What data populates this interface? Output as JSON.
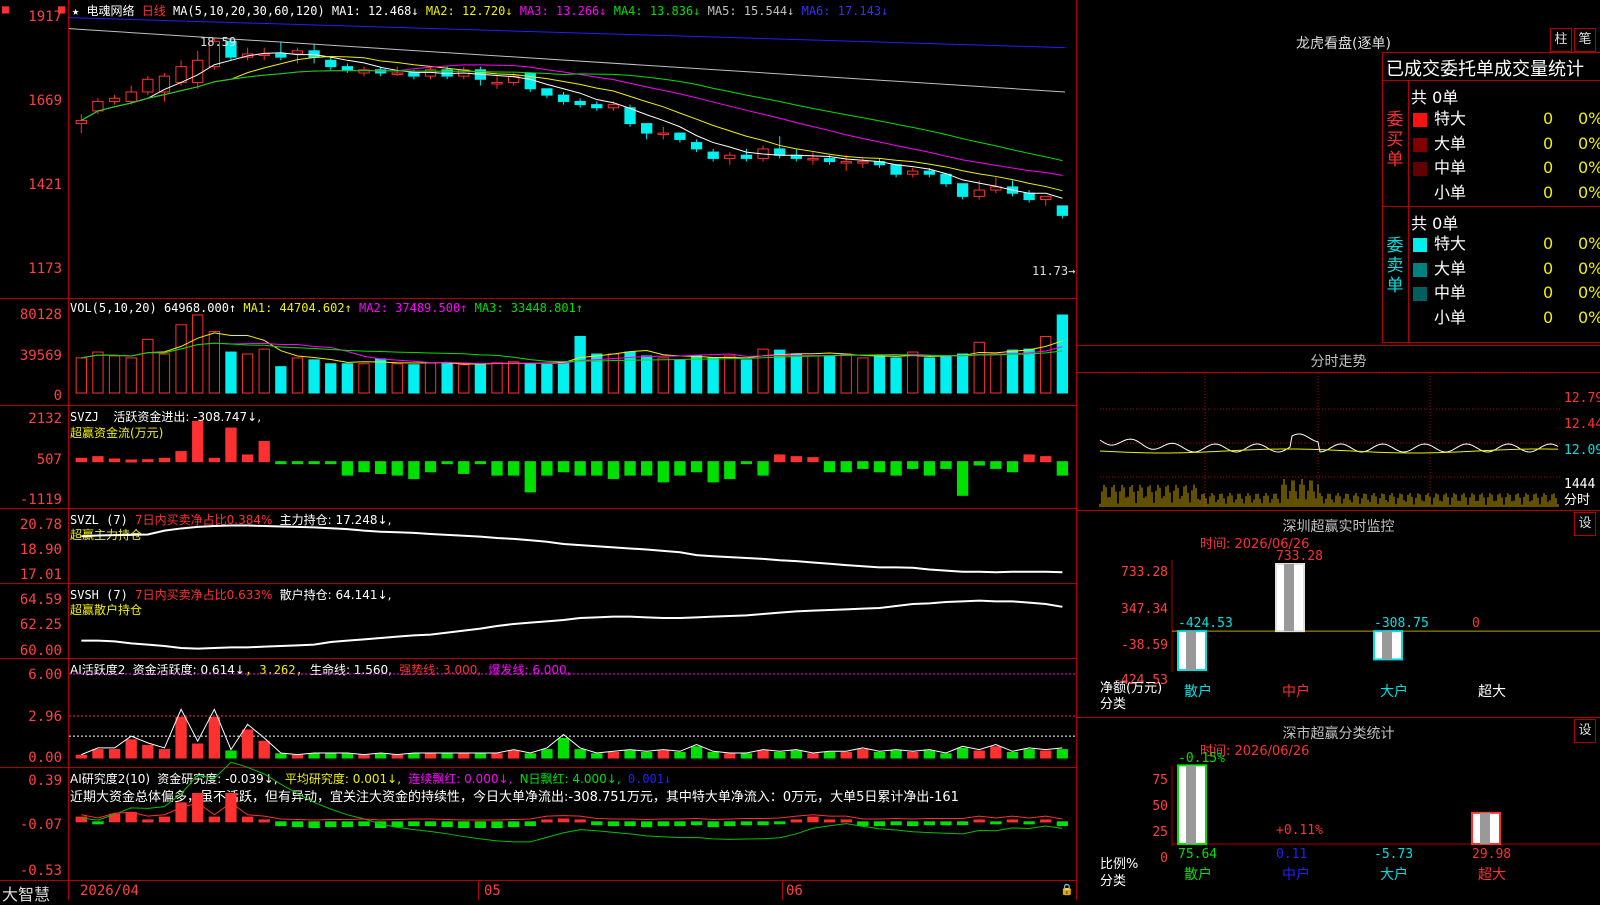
{
  "colors": {
    "up": "#ff3030",
    "down": "#00f0f0",
    "grid": "#b00000",
    "ma1": "#ffffff",
    "ma2": "#f0f000",
    "ma3": "#ff00ff",
    "ma4": "#00e000",
    "ma5": "#c0c0c0",
    "ma6": "#2020ff"
  },
  "main": {
    "title": "电魂网络",
    "period": "日线",
    "ma_params": "MA(5,10,20,30,60,120)",
    "ma1": "MA1: 12.468↓",
    "ma2": "MA2: 12.720↓",
    "ma3": "MA3: 13.266↓",
    "ma4": "MA4: 13.836↓",
    "ma5": "MA5: 15.544↓",
    "ma6": "MA6: 17.143↓",
    "high_label": "18.59",
    "low_label": "11.73→",
    "axis": [
      "1917",
      "1669",
      "1421",
      "1173"
    ]
  },
  "vol": {
    "params": "VOL(5,10,20)",
    "v": "64968.000↑",
    "ma1": "MA1: 44704.602↑",
    "ma2": "MA2: 37489.500↑",
    "ma3": "MA3: 33448.801↑",
    "axis": [
      "80128",
      "39569",
      "0"
    ]
  },
  "svzj": {
    "name": "SVZJ",
    "label": "活跃资金进出: -308.747↓,",
    "sub": "超赢资金流(万元)",
    "axis": [
      "2132",
      "507",
      "-1119"
    ]
  },
  "svzl": {
    "name": "SVZL (7)",
    "p1": "7日内买卖净占比0.384%",
    "p2": "主力持仓: 17.248↓,",
    "sub": "超赢主力持仓",
    "axis": [
      "20.78",
      "18.90",
      "17.01"
    ]
  },
  "svsh": {
    "name": "SVSH (7)",
    "p1": "7日内买卖净占比0.633%",
    "p2": "散户持仓: 64.141↓,",
    "sub": "超赢散户持仓",
    "axis": [
      "64.59",
      "62.25",
      "60.00"
    ]
  },
  "ai1": {
    "name": "AI活跃度2",
    "p1": "资金活跃度: 0.614↓",
    "p2": ", 3.262,",
    "p3": "生命线: 1.560,",
    "p4": "强势线: 3.000,",
    "p5": "爆发线: 6.000,",
    "axis": [
      "6.00",
      "2.96",
      "0.00"
    ]
  },
  "ai2": {
    "name": "AI研究度2(10)",
    "p1": "资金研究度: -0.039↓,",
    "p2": "平均研究度: 0.001↓,",
    "p3": "连续飘红: 0.000↓,",
    "p4": "N日飘红: 4.000↓,",
    "p5": "0.001↓",
    "note": "近期大资金总体偏多，虽不活跃，但有异动，宜关注大资金的持续性，今日大单净流出:-308.751万元，其中特大单净流入：0万元，大单5日累计净出-161",
    "axis": [
      "0.39",
      "-0.07",
      "-0.53"
    ]
  },
  "xaxis": {
    "brand": "大智慧",
    "d1": "2026/04",
    "d2": "05",
    "d3": "06"
  },
  "right": {
    "lhk": "龙虎看盘(逐单)",
    "btn1": "柱",
    "btn2": "笔",
    "tabs": "已成交委托单成交量统计",
    "buy": {
      "side": "委买单",
      "total": "共 0单",
      "rows": [
        {
          "name": "特大",
          "n": "0",
          "p": "0%"
        },
        {
          "name": "大单",
          "n": "0",
          "p": "0%"
        },
        {
          "name": "中单",
          "n": "0",
          "p": "0%"
        },
        {
          "name": "小单",
          "n": "0",
          "p": "0%"
        }
      ]
    },
    "sell": {
      "side": "委卖单",
      "total": "共 0单",
      "rows": [
        {
          "name": "特大",
          "n": "0",
          "p": "0%"
        },
        {
          "name": "大单",
          "n": "0",
          "p": "0%"
        },
        {
          "name": "中单",
          "n": "0",
          "p": "0%"
        },
        {
          "name": "小单",
          "n": "0",
          "p": "0%"
        }
      ]
    },
    "fs": {
      "title": "分时走势",
      "axis": [
        "12.79",
        "12.44",
        "12.09",
        "1444"
      ],
      "axis_bottom": "分时"
    },
    "mon": {
      "title": "深圳超赢实时监控",
      "btn": "设",
      "time": "时间: 2026/06/26",
      "axis": [
        "733.28",
        "347.34",
        "-38.59",
        "-424.53"
      ],
      "unit": "净额(万元)",
      "cat": "分类",
      "bars": [
        {
          "name": "散户",
          "v": -424.53,
          "label": "-424.53"
        },
        {
          "name": "中户",
          "v": 733.28,
          "label": "733.28"
        },
        {
          "name": "大户",
          "v": -308.75,
          "label": "-308.75"
        },
        {
          "name": "超大",
          "v": 0,
          "label": "0"
        }
      ]
    },
    "cls": {
      "title": "深市超赢分类统计",
      "btn": "设",
      "time": "时间: 2026/06/26",
      "axis": [
        "75",
        "50",
        "25",
        "0"
      ],
      "unit": "比例%",
      "cat": "分类",
      "bars": [
        {
          "name": "散户",
          "v": 75.64,
          "label": "75.64",
          "chg": "-0.15%"
        },
        {
          "name": "中户",
          "v": 0.11,
          "label": "0.11",
          "chg": "+0.11%"
        },
        {
          "name": "大户",
          "v": -5.73,
          "label": "-5.73",
          "chg": ""
        },
        {
          "name": "超大",
          "v": 29.98,
          "label": "29.98",
          "chg": ""
        }
      ]
    }
  },
  "chart_data": {
    "type": "candlestick",
    "candles": [
      [
        15.9,
        16.0,
        15.6,
        16.2
      ],
      [
        16.3,
        16.6,
        16.2,
        16.7
      ],
      [
        16.6,
        16.7,
        16.5,
        16.8
      ],
      [
        16.6,
        16.9,
        16.5,
        17.1
      ],
      [
        16.9,
        17.3,
        16.8,
        17.4
      ],
      [
        16.9,
        17.4,
        16.6,
        17.5
      ],
      [
        17.2,
        17.7,
        17.1,
        17.9
      ],
      [
        17.2,
        17.9,
        17.0,
        18.2
      ],
      [
        17.7,
        18.5,
        17.6,
        18.59
      ],
      [
        18.5,
        18.0,
        17.9,
        18.6
      ],
      [
        18.0,
        18.1,
        17.9,
        18.3
      ],
      [
        18.1,
        18.1,
        17.9,
        18.3
      ],
      [
        18.1,
        18.0,
        17.9,
        18.5
      ],
      [
        18.1,
        18.2,
        17.8,
        18.3
      ],
      [
        18.2,
        18.0,
        17.8,
        18.4
      ],
      [
        17.9,
        17.7,
        17.6,
        18.0
      ],
      [
        17.7,
        17.6,
        17.5,
        17.8
      ],
      [
        17.5,
        17.6,
        17.4,
        17.7
      ],
      [
        17.6,
        17.5,
        17.4,
        17.7
      ],
      [
        17.5,
        17.5,
        17.4,
        17.7
      ],
      [
        17.5,
        17.4,
        17.3,
        17.6
      ],
      [
        17.4,
        17.6,
        17.3,
        17.7
      ],
      [
        17.6,
        17.4,
        17.3,
        17.7
      ],
      [
        17.4,
        17.6,
        17.3,
        17.7
      ],
      [
        17.6,
        17.3,
        17.1,
        17.7
      ],
      [
        17.2,
        17.2,
        17.0,
        17.4
      ],
      [
        17.2,
        17.4,
        17.1,
        17.5
      ],
      [
        17.5,
        17.0,
        16.9,
        17.5
      ],
      [
        17.0,
        16.8,
        16.7,
        17.0
      ],
      [
        16.8,
        16.6,
        16.5,
        16.9
      ],
      [
        16.6,
        16.5,
        16.4,
        16.7
      ],
      [
        16.5,
        16.4,
        16.3,
        16.6
      ],
      [
        16.4,
        16.5,
        16.3,
        16.6
      ],
      [
        16.4,
        15.9,
        15.8,
        16.5
      ],
      [
        15.9,
        15.6,
        15.4,
        15.9
      ],
      [
        15.6,
        15.6,
        15.4,
        15.8
      ],
      [
        15.6,
        15.4,
        15.3,
        15.6
      ],
      [
        15.3,
        15.1,
        15.0,
        15.4
      ],
      [
        15.0,
        14.8,
        14.7,
        15.1
      ],
      [
        14.8,
        14.9,
        14.6,
        15.0
      ],
      [
        14.9,
        14.8,
        14.7,
        15.1
      ],
      [
        14.8,
        15.1,
        14.7,
        15.2
      ],
      [
        15.1,
        14.9,
        14.8,
        15.5
      ],
      [
        14.9,
        14.8,
        14.7,
        15.1
      ],
      [
        14.8,
        14.8,
        14.6,
        15.0
      ],
      [
        14.8,
        14.7,
        14.6,
        14.9
      ],
      [
        14.7,
        14.7,
        14.4,
        14.9
      ],
      [
        14.7,
        14.7,
        14.5,
        14.8
      ],
      [
        14.7,
        14.6,
        14.5,
        14.8
      ],
      [
        14.6,
        14.3,
        14.2,
        14.6
      ],
      [
        14.3,
        14.4,
        14.2,
        14.5
      ],
      [
        14.4,
        14.3,
        14.2,
        14.5
      ],
      [
        14.3,
        14.0,
        13.9,
        14.3
      ],
      [
        14.0,
        13.6,
        13.5,
        14.0
      ],
      [
        13.6,
        13.8,
        13.5,
        14.1
      ],
      [
        13.8,
        13.9,
        13.7,
        14.2
      ],
      [
        13.9,
        13.7,
        13.6,
        14.1
      ],
      [
        13.7,
        13.5,
        13.4,
        13.8
      ],
      [
        13.5,
        13.6,
        13.3,
        13.6
      ],
      [
        13.3,
        13.0,
        12.9,
        13.3
      ]
    ],
    "vol": [
      36,
      42,
      38,
      36,
      55,
      40,
      70,
      80,
      63,
      42,
      40,
      45,
      27,
      36,
      34,
      30,
      30,
      30,
      35,
      30,
      29,
      31,
      30,
      29,
      30,
      31,
      32,
      30,
      30,
      32,
      58,
      40,
      40,
      42,
      38,
      36,
      34,
      38,
      36,
      38,
      34,
      45,
      44,
      40,
      38,
      38,
      40,
      36,
      38,
      36,
      42,
      36,
      38,
      40,
      52,
      40,
      44,
      45,
      58,
      80
    ],
    "svzj": [
      10,
      15,
      8,
      5,
      6,
      10,
      30,
      120,
      10,
      100,
      20,
      60,
      -1,
      -2,
      -2,
      -3,
      -40,
      -30,
      -35,
      -40,
      -50,
      -30,
      -3,
      -35,
      -3,
      -40,
      -40,
      -90,
      -40,
      -30,
      -40,
      -40,
      -50,
      -40,
      -40,
      -60,
      -40,
      -30,
      -60,
      -50,
      -3,
      -40,
      20,
      15,
      12,
      -30,
      -30,
      -20,
      -30,
      -40,
      -20,
      -40,
      -20,
      -100,
      -10,
      -20,
      -30,
      20,
      15,
      -40
    ],
    "svzl": [
      20.3,
      20.33,
      20.35,
      20.36,
      20.38,
      20.55,
      20.65,
      20.72,
      20.76,
      20.78,
      20.78,
      20.76,
      20.74,
      20.72,
      20.7,
      20.66,
      20.62,
      20.55,
      20.5,
      20.48,
      20.45,
      20.4,
      20.36,
      20.32,
      20.28,
      20.22,
      20.18,
      20.12,
      20.05,
      19.95,
      19.9,
      19.85,
      19.8,
      19.75,
      19.7,
      19.64,
      19.58,
      19.45,
      19.4,
      19.36,
      19.32,
      19.28,
      19.22,
      19.18,
      19.12,
      19.06,
      19.0,
      18.95,
      18.9,
      18.9,
      18.88,
      18.8,
      18.75,
      18.7,
      18.7,
      18.68,
      18.7,
      18.7,
      18.7,
      18.68
    ],
    "svsh": [
      61.6,
      61.6,
      61.55,
      61.4,
      61.3,
      61.2,
      61.05,
      61.0,
      61.05,
      61.1,
      61.1,
      61.15,
      61.2,
      61.25,
      61.3,
      61.5,
      61.6,
      61.7,
      61.8,
      61.9,
      62.0,
      62.05,
      62.2,
      62.35,
      62.5,
      62.7,
      62.85,
      62.95,
      63.05,
      63.15,
      63.3,
      63.35,
      63.4,
      63.4,
      63.35,
      63.3,
      63.3,
      63.35,
      63.4,
      63.45,
      63.5,
      63.6,
      63.7,
      63.8,
      63.85,
      63.9,
      63.95,
      64.0,
      64.05,
      64.2,
      64.35,
      64.4,
      64.5,
      64.55,
      64.6,
      64.55,
      64.55,
      64.45,
      64.35,
      64.14
    ],
    "ai1": [
      0.2,
      0.6,
      0.6,
      1.3,
      0.9,
      0.6,
      2.9,
      1.0,
      2.9,
      0.5,
      2.0,
      1.2,
      0.3,
      0.2,
      0.3,
      0.3,
      0.3,
      0.2,
      0.3,
      0.2,
      0.3,
      0.3,
      0.3,
      0.3,
      0.3,
      0.3,
      0.5,
      0.3,
      0.6,
      1.4,
      0.6,
      0.3,
      0.4,
      0.5,
      0.4,
      0.5,
      0.4,
      0.8,
      0.4,
      0.3,
      0.3,
      0.5,
      0.4,
      0.5,
      0.3,
      0.4,
      0.4,
      0.6,
      0.4,
      0.5,
      0.4,
      0.5,
      0.3,
      0.7,
      0.5,
      0.8,
      0.4,
      0.6,
      0.5,
      0.6
    ],
    "ai2": [
      0.05,
      -0.02,
      0.08,
      0.1,
      0.02,
      0.05,
      0.2,
      0.3,
      0.05,
      0.3,
      0.05,
      0.02,
      -0.04,
      -0.05,
      -0.06,
      -0.05,
      -0.05,
      -0.04,
      -0.06,
      -0.05,
      -0.04,
      -0.04,
      -0.05,
      -0.06,
      -0.06,
      -0.06,
      -0.05,
      -0.04,
      0.02,
      0.03,
      0.02,
      -0.03,
      -0.04,
      -0.04,
      -0.05,
      -0.04,
      -0.04,
      -0.03,
      -0.05,
      -0.04,
      -0.03,
      -0.03,
      -0.02,
      0.02,
      0.05,
      0.02,
      0.02,
      -0.04,
      -0.04,
      -0.03,
      -0.04,
      -0.03,
      -0.03,
      -0.03,
      0.02,
      -0.02,
      0.02,
      -0.02,
      0.02,
      -0.04
    ],
    "ylim_price": [
      11.4,
      19.3
    ],
    "xlabels": [
      "2026/04",
      "05",
      "06"
    ]
  }
}
